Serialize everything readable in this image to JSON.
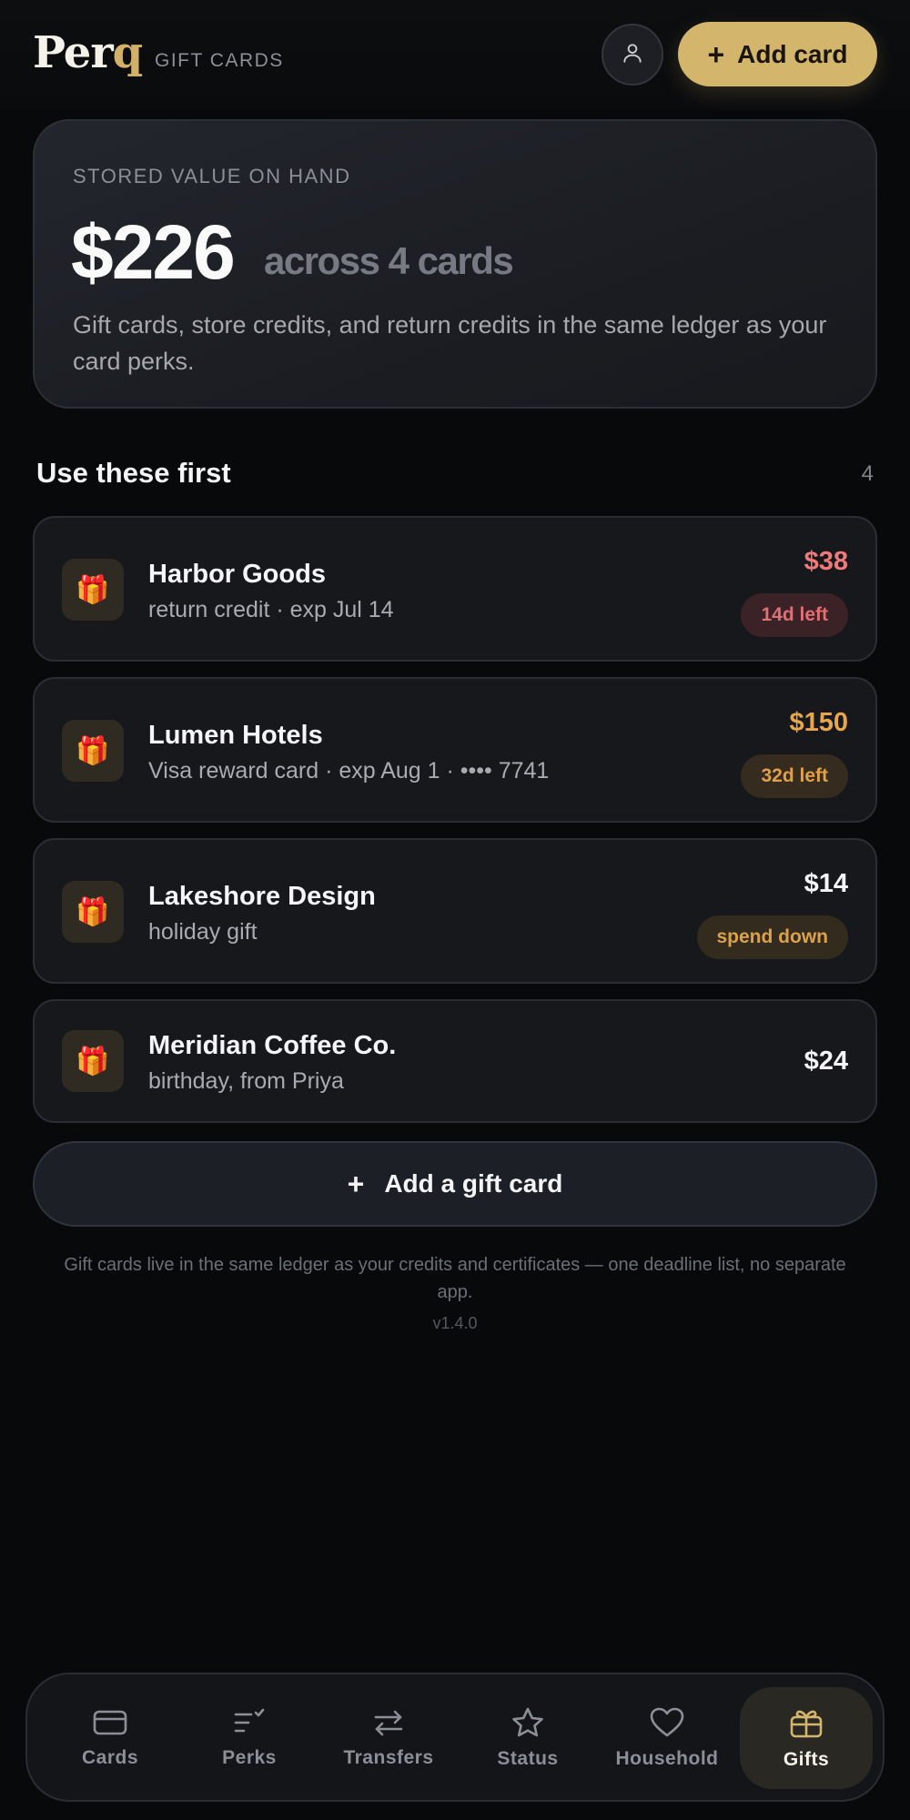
{
  "header": {
    "logo_main": "Per",
    "logo_accent": "q",
    "section": "GIFT CARDS",
    "add_label": "Add card",
    "add_icon": "+"
  },
  "summary": {
    "label": "STORED VALUE ON HAND",
    "total": "$226",
    "across": "across 4 cards",
    "description": "Gift cards, store credits, and return credits in the same ledger as your card perks."
  },
  "section": {
    "title": "Use these first",
    "count": "4"
  },
  "gifts": [
    {
      "name": "Harbor Goods",
      "meta": "return credit · exp Jul 14",
      "amount": "$38",
      "badge": "14d left",
      "amount_color": "#f07a7a",
      "badge_bg": "#3a2226",
      "badge_color": "#e26f73"
    },
    {
      "name": "Lumen Hotels",
      "meta": "Visa reward card · exp Aug 1 · •••• 7741",
      "amount": "$150",
      "badge": "32d left",
      "amount_color": "#e8a64a",
      "badge_bg": "#352b1f",
      "badge_color": "#e0a04a"
    },
    {
      "name": "Lakeshore Design",
      "meta": "holiday gift",
      "amount": "$14",
      "badge": "spend down",
      "amount_color": "#f6f6f8",
      "badge_bg": "#332b1e",
      "badge_color": "#dca24a"
    },
    {
      "name": "Meridian Coffee Co.",
      "meta": "birthday, from Priya",
      "amount": "$24",
      "amount_color": "#f6f6f8"
    }
  ],
  "add_gift": {
    "icon": "+",
    "label": "Add a gift card"
  },
  "footer": {
    "note": "Gift cards live in the same ledger as your credits and certificates — one deadline list, no separate app.",
    "version": "v1.4.0"
  },
  "nav": [
    {
      "label": "Cards",
      "icon": "card-icon"
    },
    {
      "label": "Perks",
      "icon": "perks-list-icon"
    },
    {
      "label": "Transfers",
      "icon": "transfer-arrows-icon"
    },
    {
      "label": "Status",
      "icon": "star-icon"
    },
    {
      "label": "Household",
      "icon": "heart-icon"
    },
    {
      "label": "Gifts",
      "icon": "gift-box-icon",
      "active": true
    }
  ]
}
